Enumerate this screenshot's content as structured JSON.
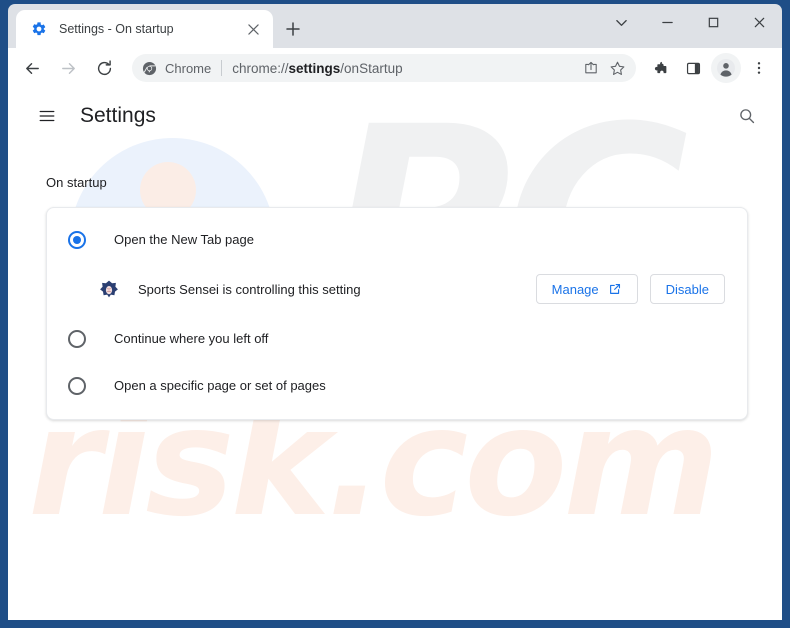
{
  "window": {
    "controls": {
      "tab_search": "tab-search-chevron",
      "minimize": "minimize",
      "maximize": "maximize",
      "close": "close"
    },
    "border_color": "#1f4e87"
  },
  "tabstrip": {
    "tabs": [
      {
        "title": "Settings - On startup",
        "favicon": "settings-gear-icon",
        "active": true
      }
    ],
    "close_label": "×",
    "new_tab_label": "+"
  },
  "toolbar": {
    "back": "back-arrow-icon",
    "forward": "forward-arrow-icon",
    "reload": "reload-icon",
    "omnibox": {
      "chip_icon": "chrome-logo-icon",
      "chip_label": "Chrome",
      "url_prefix": "chrome://",
      "url_bold": "settings",
      "url_suffix": "/onStartup",
      "full_url": "chrome://settings/onStartup",
      "share_icon": "share-icon",
      "bookmark_icon": "bookmark-star-icon"
    },
    "extensions_icon": "extensions-puzzle-icon",
    "side_panel_icon": "side-panel-icon",
    "profile_icon": "profile-avatar-icon",
    "menu_icon": "three-dot-menu-icon"
  },
  "settings": {
    "menu_icon": "hamburger-menu-icon",
    "title": "Settings",
    "search_icon": "search-icon",
    "section_label": "On startup",
    "options": [
      {
        "label": "Open the New Tab page",
        "checked": true
      },
      {
        "label": "Continue where you left off",
        "checked": false
      },
      {
        "label": "Open a specific page or set of pages",
        "checked": false
      }
    ],
    "controlled_by": {
      "icon": "sports-sensei-extension-icon",
      "text": "Sports Sensei is controlling this setting",
      "manage_label": "Manage",
      "manage_icon": "external-link-icon",
      "disable_label": "Disable"
    },
    "accent_color": "#1a73e8"
  },
  "watermark": {
    "logo_text": "PC",
    "domain_text": "risk.com"
  }
}
